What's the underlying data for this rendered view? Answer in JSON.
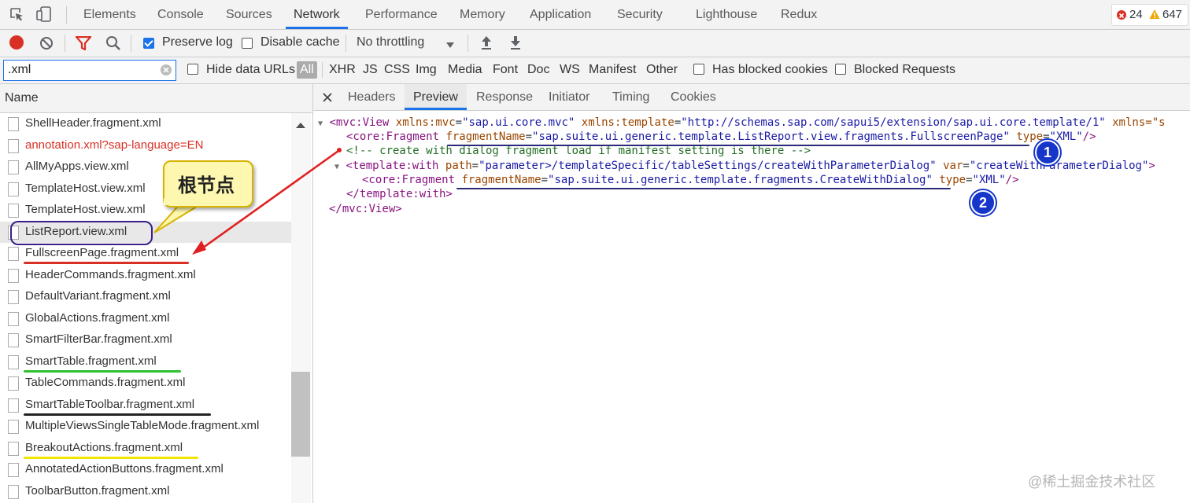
{
  "panel_tabs": [
    "Elements",
    "Console",
    "Sources",
    "Network",
    "Performance",
    "Memory",
    "Application",
    "Security",
    "Lighthouse",
    "Redux"
  ],
  "errors_count": "24",
  "warnings_count": "647",
  "toolbar": {
    "preserve_log": "Preserve log",
    "disable_cache": "Disable cache",
    "throttling": "No throttling"
  },
  "filter": {
    "value": ".xml",
    "hide_data_urls": "Hide data URLs",
    "types": [
      "All",
      "XHR",
      "JS",
      "CSS",
      "Img",
      "Media",
      "Font",
      "Doc",
      "WS",
      "Manifest",
      "Other"
    ],
    "has_blocked_cookies": "Has blocked cookies",
    "blocked_requests": "Blocked Requests"
  },
  "name_column": "Name",
  "files": [
    "ShellHeader.fragment.xml",
    "annotation.xml?sap-language=EN",
    "AllMyApps.view.xml",
    "TemplateHost.view.xml",
    "TemplateHost.view.xml",
    "ListReport.view.xml",
    "FullscreenPage.fragment.xml",
    "HeaderCommands.fragment.xml",
    "DefaultVariant.fragment.xml",
    "GlobalActions.fragment.xml",
    "SmartFilterBar.fragment.xml",
    "SmartTable.fragment.xml",
    "TableCommands.fragment.xml",
    "SmartTableToolbar.fragment.xml",
    "MultipleViewsSingleTableMode.fragment.xml",
    "BreakoutActions.fragment.xml",
    "AnnotatedActionButtons.fragment.xml",
    "ToolbarButton.fragment.xml"
  ],
  "detail_tabs": [
    "Headers",
    "Preview",
    "Response",
    "Initiator",
    "Timing",
    "Cookies"
  ],
  "xml": {
    "l1_tag": "<mvc:View",
    "l1_a1": "xmlns:mvc",
    "l1_v1": "\"sap.ui.core.mvc\"",
    "l1_a2": "xmlns:template",
    "l1_v2": "\"http://schemas.sap.com/sapui5/extension/sap.ui.core.template/1\"",
    "l1_a3": "xmlns=\"s",
    "l2_tag": "<core:Fragment",
    "l2_a1": "fragmentName",
    "l2_v1": "\"sap.suite.ui.generic.template.ListReport.view.fragments.FullscreenPage\"",
    "l2_a2": "type",
    "l2_v2": "\"XML\"",
    "l2_end": "/>",
    "l3_comment": "<!-- create with dialog fragment load if manifest setting is there -->",
    "l4_tag": "<template:with",
    "l4_a1": "path",
    "l4_v1": "\"parameter>/templateSpecific/tableSettings/createWithParameterDialog\"",
    "l4_a2": "var",
    "l4_v2": "\"createWithParameterDialog\"",
    "l4_end": ">",
    "l5_tag": "<core:Fragment",
    "l5_a1": "fragmentName",
    "l5_v1": "\"sap.suite.ui.generic.template.fragments.CreateWithDialog\"",
    "l5_a2": "type",
    "l5_v2": "\"XML\"",
    "l5_end": "/>",
    "l6": "</template:with>",
    "l7": "</mvc:View>"
  },
  "annotations": {
    "callout": "根节点",
    "badge1": "1",
    "badge2": "2"
  },
  "watermark": "@稀土掘金技术社区"
}
